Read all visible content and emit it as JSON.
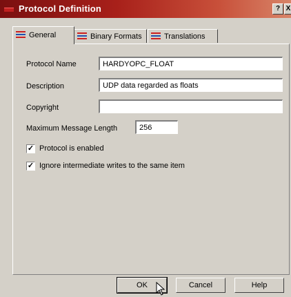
{
  "window": {
    "title": "Protocol Definition",
    "help_glyph": "?",
    "close_glyph": "X",
    "accent_color": "#a8201a"
  },
  "tabs": [
    {
      "label": "General",
      "icon": "protocol-icon",
      "active": true
    },
    {
      "label": "Binary Formats",
      "icon": "protocol-icon",
      "active": false
    },
    {
      "label": "Translations",
      "icon": "protocol-icon",
      "active": false
    }
  ],
  "form": {
    "protocol_name_label": "Protocol Name",
    "protocol_name_value": "HARDYOPC_FLOAT",
    "description_label": "Description",
    "description_value": "UDP data regarded as floats",
    "copyright_label": "Copyright",
    "copyright_value": "",
    "max_length_label": "Maximum Message Length",
    "max_length_value": "256"
  },
  "options": {
    "enabled_label": "Protocol is enabled",
    "enabled_checked": true,
    "ignore_label": "Ignore intermediate writes to the same item",
    "ignore_checked": true,
    "check_glyph": "✓"
  },
  "buttons": {
    "ok_label": "OK",
    "cancel_label": "Cancel",
    "help_label": "Help"
  }
}
